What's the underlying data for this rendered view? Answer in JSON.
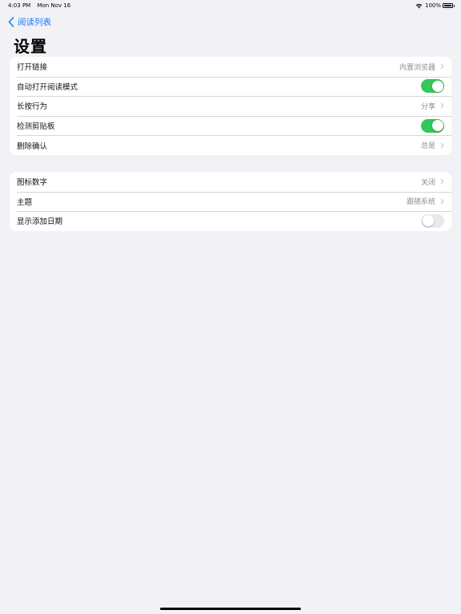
{
  "status_bar": {
    "time": "4:03 PM",
    "date": "Mon Nov 16",
    "battery": "100%",
    "icons": [
      "wifi-icon",
      "battery-icon"
    ]
  },
  "nav": {
    "back_label": "阅读列表",
    "back_icon": "chevron-left-icon",
    "title": "设置"
  },
  "colors": {
    "accent": "#1a7cf5",
    "toggle_on": "#34c759",
    "background": "#f2f1f6"
  },
  "groups": [
    {
      "rows": [
        {
          "label": "打开链接",
          "value": "内置浏览器",
          "type": "disclosure"
        },
        {
          "label": "自动打开阅读模式",
          "value": "on",
          "type": "toggle"
        },
        {
          "label": "长按行为",
          "value": "分享",
          "type": "disclosure"
        },
        {
          "label": "检测剪贴板",
          "value": "on",
          "type": "toggle"
        },
        {
          "label": "删除确认",
          "value": "总是",
          "type": "disclosure"
        }
      ]
    },
    {
      "rows": [
        {
          "label": "图标数字",
          "value": "关闭",
          "type": "disclosure"
        },
        {
          "label": "主题",
          "value": "跟随系统",
          "type": "disclosure"
        },
        {
          "label": "显示添加日期",
          "value": "off",
          "type": "toggle"
        }
      ]
    }
  ]
}
